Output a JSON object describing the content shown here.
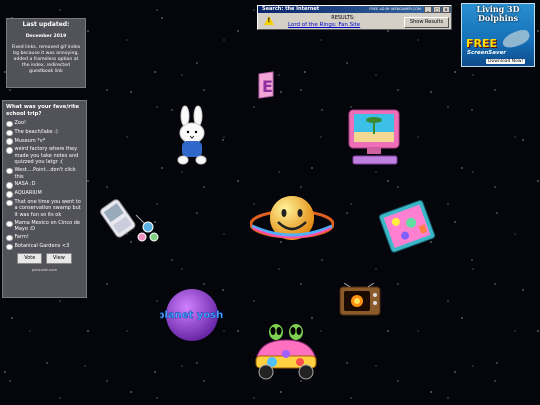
{
  "update": {
    "title": "Last updated:",
    "date": "December 2019",
    "text": "Fixed links, removed gif index bg because it was annoying, added a frameless option at the index, redirected guestbook link"
  },
  "poll": {
    "question": "What was your fave/rite school trip?",
    "options": [
      "Zoo!",
      "The beach/lake :)",
      "Museum *v*",
      "weird factory where they made you take notes and quizzed you latgr :(",
      "West....Point...don't click this",
      "NASA :D",
      "AQUARIUM",
      "That one time you went to a conservation swamp but it was fun so its ok",
      "Mama Mexico on Cinco de Mayo :D",
      "Farm!",
      "Botanical Gardens <3"
    ],
    "vote_label": "Vote",
    "view_label": "View",
    "footer": "pollcode.com"
  },
  "popup": {
    "title": "Search: the Internet",
    "small_text": "FREE AD BY WEBGAMER.COM",
    "results_label": "RESULTS:",
    "result_link": "Lord of the Rings: Fan Site",
    "show_button": "Show Results"
  },
  "ad": {
    "headline": "Living 3D Dolphins",
    "free": "FREE",
    "subtitle": "ScreenSaver",
    "download": "Download Now!"
  },
  "planet_text": "planet yoshi",
  "colors": {
    "background": "#05050c",
    "panel": "#52525a",
    "link": "#0000cc"
  }
}
